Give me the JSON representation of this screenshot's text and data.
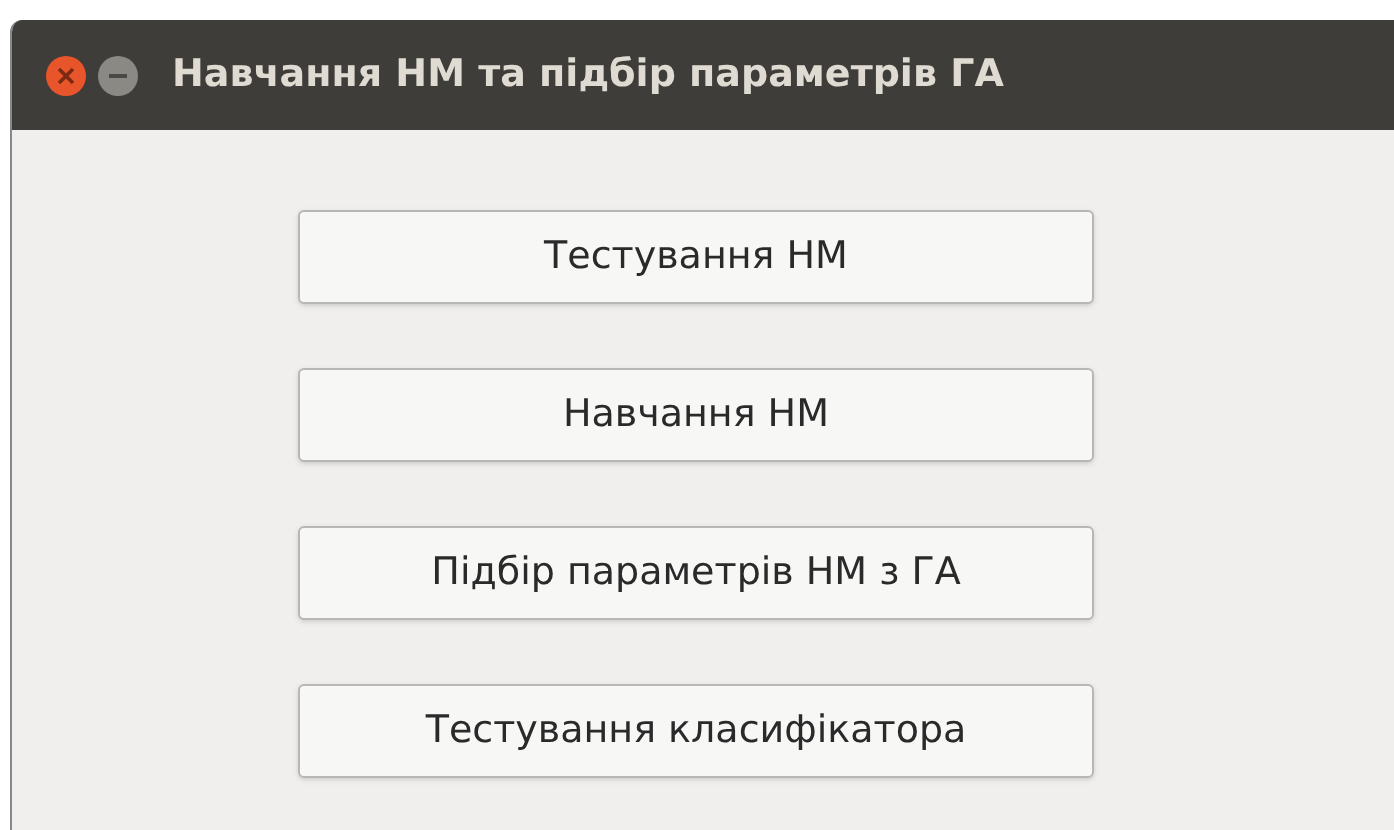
{
  "window": {
    "title": "Навчання НМ та підбір параметрів ГА"
  },
  "buttons": [
    "Тестування НМ",
    "Навчання НМ",
    "Підбір параметрів НМ з ГА",
    "Тестування класифікатора"
  ]
}
